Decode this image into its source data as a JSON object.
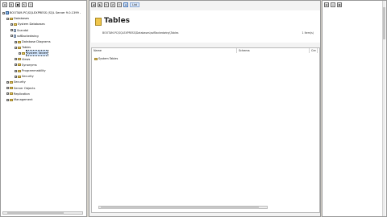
{
  "left": {
    "tree": [
      {
        "label": "BOOTAM-PC\\SQLEXPRESS (SQL Server 9.0.1399 -",
        "level": 0,
        "exp": "−",
        "icon": "server-icon"
      },
      {
        "label": "Databases",
        "level": 1,
        "exp": "−",
        "icon": "folder-icon"
      },
      {
        "label": "System Databases",
        "level": 2,
        "exp": "+",
        "icon": "folder-icon"
      },
      {
        "label": "Scandal",
        "level": 2,
        "exp": "+",
        "icon": "db-icon"
      },
      {
        "label": "ssfBackedwing",
        "level": 2,
        "exp": "−",
        "icon": "db-icon"
      },
      {
        "label": "Database Diagrams",
        "level": 3,
        "exp": "+",
        "icon": "folder-icon"
      },
      {
        "label": "Tables",
        "level": 3,
        "exp": "−",
        "icon": "folder-icon"
      },
      {
        "label": "System Tables",
        "level": 4,
        "exp": "+",
        "icon": "folder-icon",
        "selected": true
      },
      {
        "label": "Views",
        "level": 3,
        "exp": "+",
        "icon": "folder-icon"
      },
      {
        "label": "Synonyms",
        "level": 3,
        "exp": "+",
        "icon": "folder-icon"
      },
      {
        "label": "Programmability",
        "level": 3,
        "exp": "+",
        "icon": "folder-icon"
      },
      {
        "label": "Security",
        "level": 3,
        "exp": "+",
        "icon": "folder-icon"
      },
      {
        "label": "Security",
        "level": 1,
        "exp": "+",
        "icon": "folder-icon"
      },
      {
        "label": "Server Objects",
        "level": 1,
        "exp": "+",
        "icon": "folder-icon"
      },
      {
        "label": "Replication",
        "level": 1,
        "exp": "+",
        "icon": "folder-icon"
      },
      {
        "label": "Management",
        "level": 1,
        "exp": "+",
        "icon": "folder-icon"
      }
    ]
  },
  "center": {
    "toolbar": {
      "list_label": "List"
    },
    "title": "Tables",
    "path": "BOOTAM-PC\\SQLEXPRESS\\Databases\\ssfBackedwing\\Tables",
    "count": "1 Item(s)",
    "columns": [
      "Name",
      "Schema",
      "Cre"
    ],
    "rows": [
      {
        "name": "System Tables"
      }
    ]
  }
}
